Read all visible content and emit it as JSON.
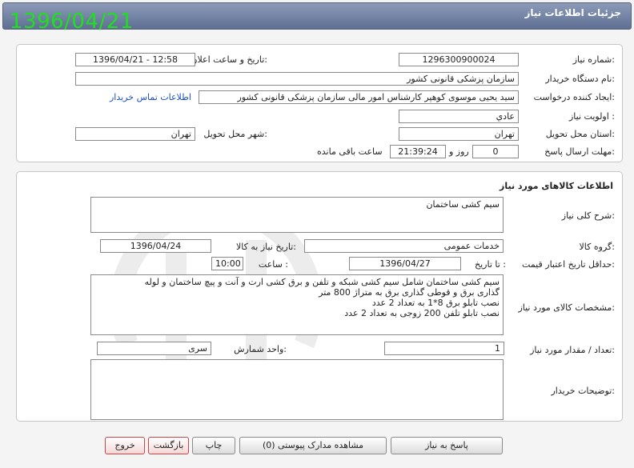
{
  "header": {
    "title": "جزئیات اطلاعات نیاز",
    "stamp": "1396/04/21"
  },
  "info": {
    "need_number_label": "شماره نیاز:",
    "need_number": "1296300900024",
    "announce_label": "تاریخ و ساعت اعلان عمومی:",
    "announce_value": "1396/04/21 - 12:58",
    "buyer_org_label": "نام دستگاه خریدار:",
    "buyer_org": "سازمان پزشکی قانونی کشور",
    "requester_label": "ایجاد کننده درخواست:",
    "requester": "سید یحیی موسوی کوهپر کارشناس امور مالی سازمان پزشکی قانونی کشور",
    "contact_link": "اطلاعات تماس خریدار",
    "priority_label": "اولویت نیاز :",
    "priority": "عادي",
    "province_label": "استان محل تحویل:",
    "province": "تهران",
    "city_label": "شهر محل تحویل:",
    "city": "تهران",
    "deadline_label": "مهلت ارسال پاسخ:",
    "days": "0",
    "days_unit": "روز و",
    "time": "21:39:24",
    "time_unit": "ساعت باقی مانده"
  },
  "goods": {
    "section_title": "اطلاعات کالاهای مورد نیاز",
    "summary_label": "شرح کلی نیاز:",
    "summary": "سیم کشی ساختمان",
    "group_label": "گروه کالا:",
    "group": "خدمات عمومی",
    "need_date_label": "تاریخ نیاز به کالا:",
    "need_date": "1396/04/24",
    "validity_label": "حداقل تاریخ اعتبار قیمت:",
    "to_date_label": "تا تاریخ :",
    "to_date": "1396/04/27",
    "hour_label": "ساعت :",
    "hour": "10:00",
    "spec_label": "مشخصات کالای مورد نیاز:",
    "spec_lines": [
      "سیم کشی ساختمان شامل سیم کشی شبکه و تلفن و برق کشی ارت و آنت و پیچ ساختمان و لوله",
      "گذاری برق و قوطی گذاری برق به متراژ 800 متر",
      "نصب تابلو برق 8*1 به تعداد 2 عدد",
      "نصب تابلو تلفن 200 زوجی به تعداد 2 عدد"
    ],
    "qty_label": "تعداد / مقدار مورد نیاز:",
    "qty": "1",
    "unit_label": "واحد شمارش:",
    "unit": "سری",
    "buyer_notes_label": "توضیحات خریدار:",
    "buyer_notes": ""
  },
  "buttons": {
    "reply": "پاسخ به نیاز",
    "attachments": "مشاهده مدارک پیوستی (0)",
    "print": "چاپ",
    "back": "بازگشت",
    "exit": "خروج"
  }
}
